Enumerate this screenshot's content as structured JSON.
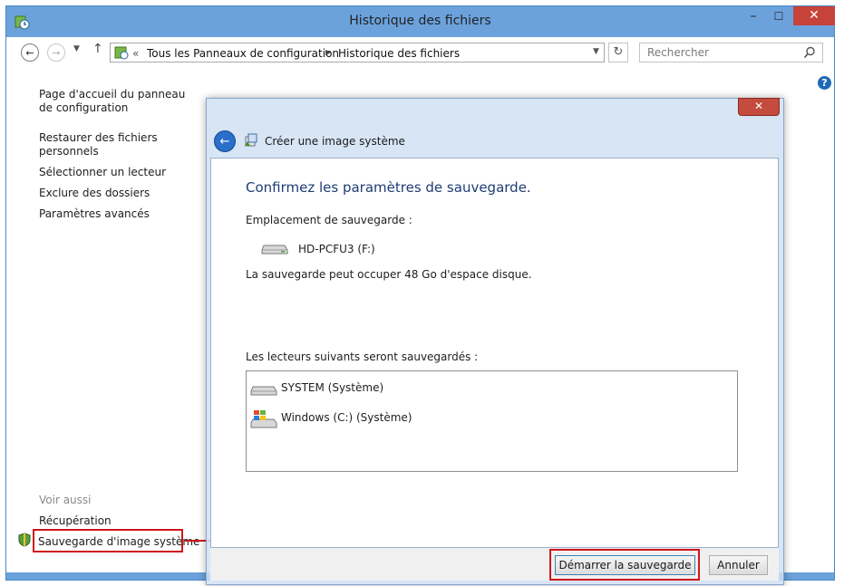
{
  "window": {
    "title": "Historique des fichiers",
    "caption_minimize": "–",
    "caption_maximize": "☐",
    "caption_close": "✕"
  },
  "toolbar": {
    "breadcrumb_prefix": "«",
    "breadcrumb": [
      "Tous les Panneaux de configuration",
      "Historique des fichiers"
    ],
    "search_placeholder": "Rechercher"
  },
  "sidebar": {
    "items": [
      {
        "label": "Page d'accueil du panneau de configuration"
      },
      {
        "label": "Restaurer des fichiers personnels"
      },
      {
        "label": "Sélectionner un lecteur"
      },
      {
        "label": "Exclure des dossiers"
      },
      {
        "label": "Paramètres avancés"
      }
    ],
    "see_also_heading": "Voir aussi",
    "see_also": [
      {
        "label": "Récupération"
      },
      {
        "label": "Sauvegarde d'image système"
      }
    ]
  },
  "dialog": {
    "title": "Créer une image système",
    "close": "✕",
    "heading": "Confirmez les paramètres de sauvegarde.",
    "location_label": "Emplacement de sauvegarde :",
    "location_drive": "HD-PCFU3 (F:)",
    "space_note": "La sauvegarde peut occuper 48 Go d'espace disque.",
    "drives_label": "Les lecteurs suivants seront sauvegardés :",
    "drives": [
      {
        "label": "SYSTEM (Système)",
        "icon": "hard-drive-icon"
      },
      {
        "label": "Windows (C:) (Système)",
        "icon": "windows-drive-icon"
      }
    ],
    "start_button": "Démarrer la sauvegarde",
    "cancel_button": "Annuler"
  },
  "colors": {
    "frame": "#6ba2dc",
    "close_red": "#c7433a",
    "highlight_red": "#d0161b",
    "heading_blue": "#1e3c74"
  }
}
